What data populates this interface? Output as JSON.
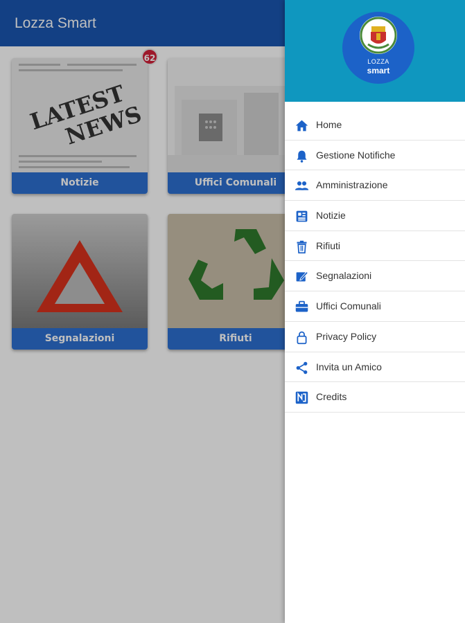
{
  "appbar": {
    "title": "Lozza Smart"
  },
  "tiles": [
    {
      "caption": "Notizie",
      "badge": "62"
    },
    {
      "caption": "Uffici Comunali"
    },
    {
      "caption": "Segnalazioni"
    },
    {
      "caption": "Rifiuti"
    }
  ],
  "tile_art_text": {
    "line1": "LATEST",
    "line2": "NEWS"
  },
  "drawer": {
    "logo": {
      "line1": "LOZZA",
      "line2": "smart"
    },
    "items": [
      {
        "label": "Home",
        "icon": "home-icon"
      },
      {
        "label": "Gestione Notifiche",
        "icon": "bell-icon"
      },
      {
        "label": "Amministrazione",
        "icon": "people-icon"
      },
      {
        "label": "Notizie",
        "icon": "newspaper-icon"
      },
      {
        "label": "Rifiuti",
        "icon": "trash-icon"
      },
      {
        "label": "Segnalazioni",
        "icon": "edit-icon"
      },
      {
        "label": "Uffici Comunali",
        "icon": "briefcase-icon"
      },
      {
        "label": "Privacy Policy",
        "icon": "lock-icon"
      },
      {
        "label": "Invita un Amico",
        "icon": "share-icon"
      },
      {
        "label": "Credits",
        "icon": "credits-icon"
      }
    ]
  },
  "colors": {
    "appbar": "#1a56b0",
    "drawer_header": "#0f97bf",
    "accent": "#1c62c8",
    "badge": "#d2223a"
  }
}
